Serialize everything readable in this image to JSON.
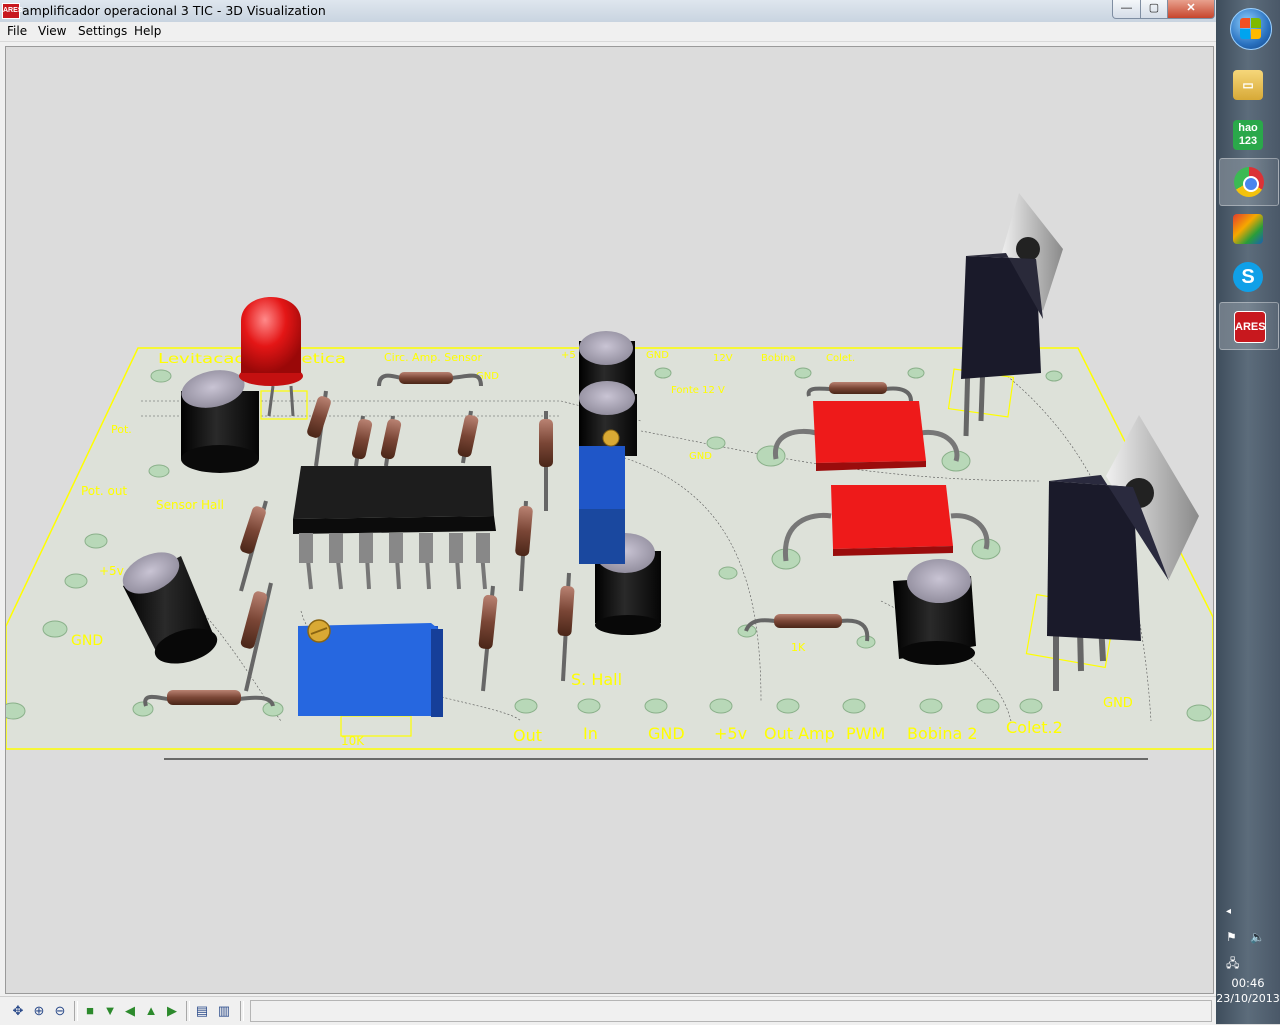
{
  "window": {
    "title": "amplificador operacional 3 TIC - 3D Visualization",
    "app_badge": "ARES",
    "controls": {
      "minimize": "—",
      "maximize": "▢",
      "close": "✕"
    }
  },
  "menu": [
    "File",
    "View",
    "Settings",
    "Help"
  ],
  "pcb": {
    "top_labels": [
      "Levitacao Magnetica",
      "Circ. Amp. Sensor",
      "GND",
      "+5",
      "GND",
      "12V",
      "Bobina",
      "Colet."
    ],
    "fonte_label": "Fonte 12 V",
    "left_labels": [
      "Pot.",
      "Pot. out",
      "Sensor Hall",
      "+5v",
      "GND"
    ],
    "trimmer_label": "10K",
    "sensor_label": "S. Hall",
    "gnd_mid": "GND",
    "resistor_label_right": "1K",
    "transistor_gnd": "GND",
    "bottom_labels": [
      "Out",
      "In",
      "GND",
      "+5v",
      "Out Amp",
      "PWM",
      "Bobina 2",
      "Colet.2"
    ],
    "colors": {
      "board": "#dde1d9",
      "silkscreen": "#ffff00",
      "capacitor": "#151515",
      "led": "#e01010",
      "relay": "#e81414",
      "trimpot": "#2060d8"
    }
  },
  "taskbar": {
    "apps": [
      "explorer-icon",
      "hao123-icon",
      "chrome-icon",
      "winamp-icon",
      "skype-icon",
      "ares-icon"
    ],
    "hao123_text": "hao 123",
    "ares_text": "ARES",
    "clock_time": "00:46",
    "clock_date": "23/10/2013"
  }
}
